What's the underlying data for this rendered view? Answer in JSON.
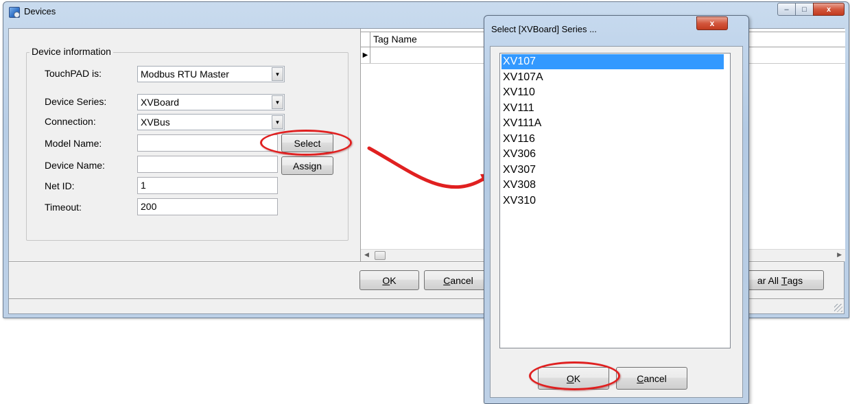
{
  "main_window": {
    "title": "Devices",
    "caption": {
      "minimize": "–",
      "maximize": "□",
      "close": "x"
    },
    "group_title": "Device information",
    "fields": {
      "touchpad_label": "TouchPAD is:",
      "touchpad_value": "Modbus RTU Master",
      "series_label": "Device Series:",
      "series_value": "XVBoard",
      "connection_label": "Connection:",
      "connection_value": "XVBus",
      "model_label": "Model Name:",
      "model_value": "",
      "device_name_label": "Device Name:",
      "device_name_value": "",
      "netid_label": "Net ID:",
      "netid_value": "1",
      "timeout_label": "Timeout:",
      "timeout_value": "200"
    },
    "buttons": {
      "select": "Select",
      "assign": "Assign",
      "ok_prefix": "",
      "ok_u": "O",
      "ok_rest": "K",
      "cancel_u": "C",
      "cancel_rest": "ancel",
      "clear_tags_prefix": "ar All ",
      "clear_tags_u": "T",
      "clear_tags_rest": "ags"
    },
    "grid": {
      "columns": [
        "Tag Name"
      ],
      "row_indicator": "▶"
    }
  },
  "select_dialog": {
    "title": "Select [XVBoard] Series ...",
    "close": "x",
    "items": [
      "XV107",
      "XV107A",
      "XV110",
      "XV111",
      "XV111A",
      "XV116",
      "XV306",
      "XV307",
      "XV308",
      "XV310"
    ],
    "selected_item": "XV107",
    "buttons": {
      "ok_u": "O",
      "ok_rest": "K",
      "cancel_u": "C",
      "cancel_rest": "ancel"
    }
  },
  "colors": {
    "annotation": "#e02020",
    "selection": "#3399ff"
  }
}
